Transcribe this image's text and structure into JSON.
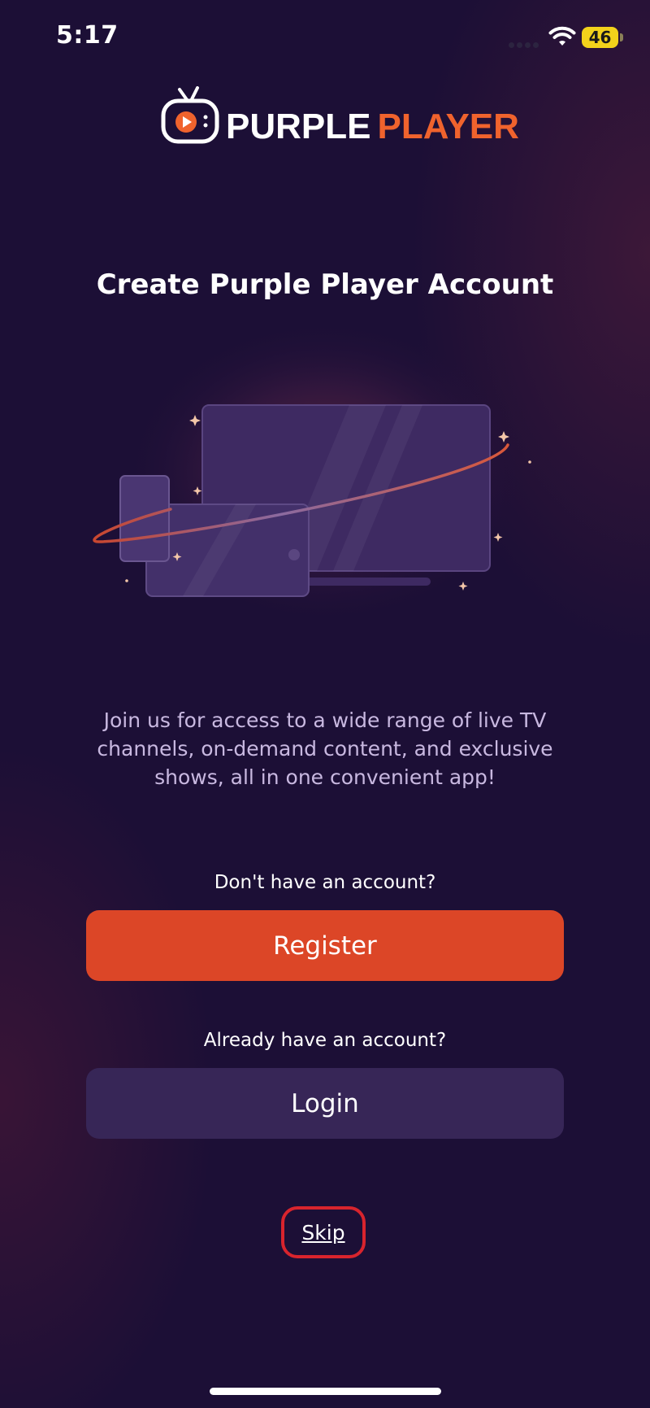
{
  "status_bar": {
    "time": "5:17",
    "battery_level": "46",
    "icons": [
      "wifi-icon",
      "battery-icon"
    ]
  },
  "logo": {
    "word_1": "PURPLE",
    "word_2": "PLAYER",
    "icon": "tv-play-icon"
  },
  "main": {
    "title": "Create Purple Player Account",
    "description": "Join us for access to a wide range of live TV channels, on-demand content, and exclusive shows, all in one convenient app!",
    "register_prompt": "Don't have an account?",
    "register_label": "Register",
    "login_prompt": "Already have an account?",
    "login_label": "Login",
    "skip_label": "Skip"
  },
  "colors": {
    "background": "#1c0f36",
    "accent": "#dc4627",
    "secondary_button": "#372657",
    "logo_accent": "#f0632d",
    "highlight_outline": "#d8242d"
  }
}
